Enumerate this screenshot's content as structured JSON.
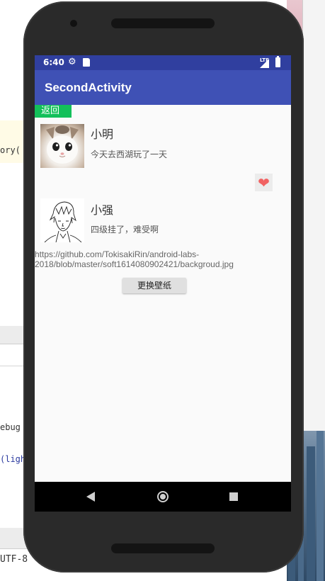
{
  "desktop": {
    "code_lines": [
      "ory(",
      "ebug",
      "(ligh"
    ],
    "encoding": "UTF-8"
  },
  "statusbar": {
    "time": "6:40",
    "settings_icon": "gear-icon",
    "sd_icon": "sd-card-icon",
    "network": "LTE",
    "signal_icon": "signal-icon",
    "battery_icon": "battery-icon"
  },
  "appbar": {
    "title": "SecondActivity"
  },
  "back_button": {
    "label": "返回"
  },
  "contacts": [
    {
      "name": "小明",
      "message": "今天去西湖玩了一天",
      "avatar": "cat-avatar"
    },
    {
      "name": "小强",
      "message": "四级挂了，难受啊",
      "avatar": "sketch-man-avatar"
    }
  ],
  "like_button": {
    "icon": "heart-icon",
    "color": "#f16262"
  },
  "wallpaper_url": "https://github.com/TokisakiRin/android-labs-2018/blob/master/soft1614080902421/backgroud.jpg",
  "change_button": {
    "label": "更换壁纸"
  },
  "navbar": {
    "back_icon": "nav-back-icon",
    "home_icon": "nav-home-icon",
    "recent_icon": "nav-recent-icon"
  },
  "colors": {
    "status_bar": "#303f9f",
    "app_bar": "#3f51b5",
    "back_button": "#13c05a"
  }
}
